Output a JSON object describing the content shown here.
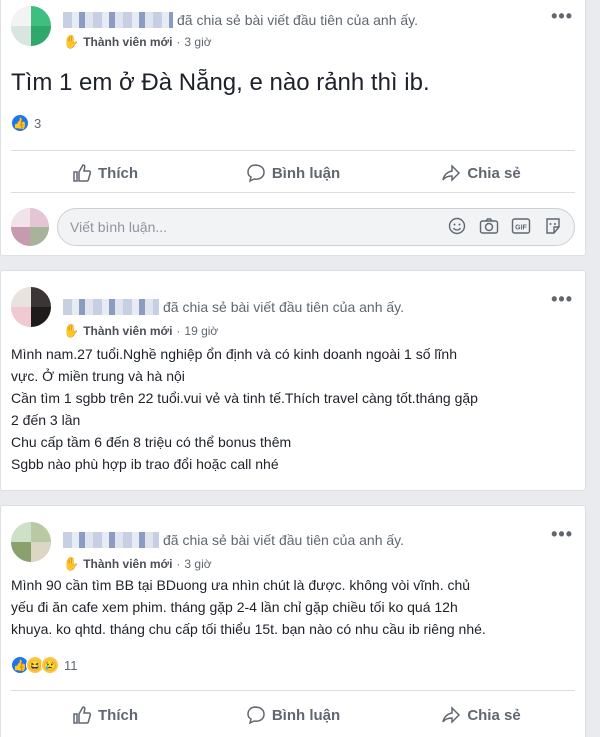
{
  "common": {
    "shared_text": "đã chia sẻ bài viết đầu tiên của anh ấy.",
    "member_label": "Thành viên mới",
    "separator": "·",
    "more_label": "•••",
    "like_label": "Thích",
    "comment_label": "Bình luận",
    "share_label": "Chia sẻ"
  },
  "posts": [
    {
      "time": "3 giờ",
      "text": "Tìm 1 em ở Đà Nẵng, e nào rảnh thì ib.",
      "reaction_count": "3",
      "comment_placeholder": "Viết bình luận..."
    },
    {
      "time": "19 giờ",
      "lines": [
        "Mình nam.27 tuổi.Nghề nghiệp ổn định và có kinh doanh ngoài 1 số lĩnh",
        "vực. Ở miền trung và hà nội",
        "Cần tìm 1 sgbb trên 22 tuổi.vui vẻ và tinh tế.Thích travel càng tốt.tháng gặp",
        "2 đến 3 lần",
        "Chu cấp tầm 6 đến 8 triệu có thể bonus thêm",
        "Sgbb nào phù hợp ib trao đổi hoặc call nhé"
      ]
    },
    {
      "time": "3 giờ",
      "lines": [
        "Mình 90 cần tìm BB tại BDuong ưa nhìn chút là được. không vòi vĩnh. chủ",
        "yếu đi ăn cafe xem phim. tháng gặp 2-4 lần chỉ gặp chiều tối ko quá 12h",
        "khuya. ko qhtd. tháng chu cấp tối thiểu 15t. bạn nào có nhu cầu ib riêng nhé."
      ],
      "reaction_count": "11"
    }
  ],
  "colors": {
    "facebook_blue": "#1877f2",
    "text_primary": "#1d2129",
    "text_secondary": "#606770",
    "background": "#e9ebee"
  },
  "icons": [
    "hand-wave-icon",
    "more-icon",
    "like-icon",
    "comment-icon",
    "share-icon",
    "emoji-icon",
    "camera-icon",
    "gif-icon",
    "sticker-icon"
  ]
}
